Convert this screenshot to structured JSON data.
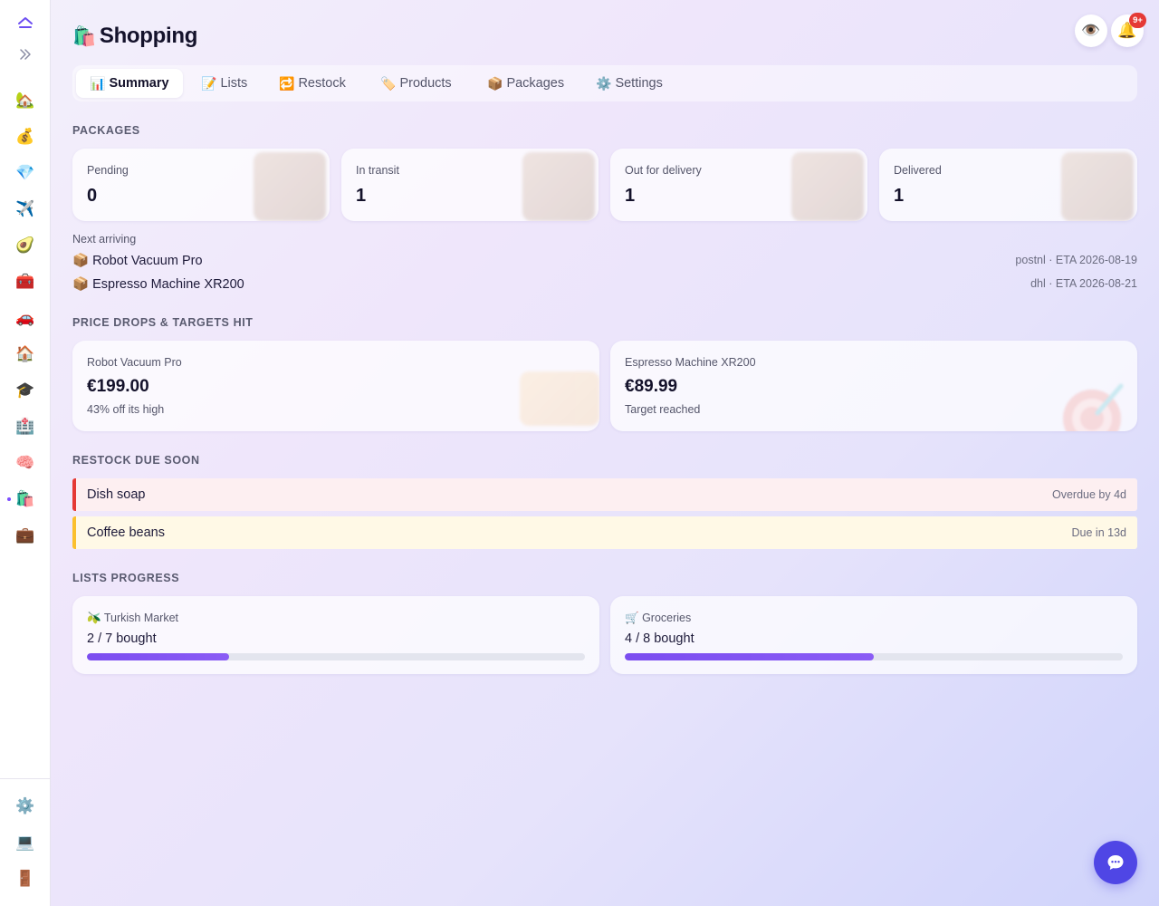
{
  "sidebar": {
    "top": [
      {
        "name": "home-up-icon",
        "glyph": "⏶"
      },
      {
        "name": "expand-icon",
        "glyph": "»"
      }
    ],
    "items": [
      {
        "name": "sidebar-item-house-building",
        "glyph": "🏡"
      },
      {
        "name": "sidebar-item-money",
        "glyph": "💰"
      },
      {
        "name": "sidebar-item-gem",
        "glyph": "💎"
      },
      {
        "name": "sidebar-item-travel",
        "glyph": "✈️"
      },
      {
        "name": "sidebar-item-food",
        "glyph": "🥑"
      },
      {
        "name": "sidebar-item-toolbox",
        "glyph": "🧰"
      },
      {
        "name": "sidebar-item-car",
        "glyph": "🚗"
      },
      {
        "name": "sidebar-item-home",
        "glyph": "🏠"
      },
      {
        "name": "sidebar-item-education",
        "glyph": "🎓"
      },
      {
        "name": "sidebar-item-health",
        "glyph": "🏥"
      },
      {
        "name": "sidebar-item-brain",
        "glyph": "🧠"
      },
      {
        "name": "sidebar-item-shopping",
        "glyph": "🛍️",
        "active": true
      },
      {
        "name": "sidebar-item-work",
        "glyph": "💼"
      }
    ],
    "bottom": [
      {
        "name": "settings-gear-icon",
        "glyph": "⚙️"
      },
      {
        "name": "laptop-icon",
        "glyph": "💻"
      },
      {
        "name": "logout-door-icon",
        "glyph": "🚪"
      }
    ]
  },
  "header": {
    "icon": "🛍️",
    "title": "Shopping",
    "eye_icon": "👁️",
    "bell_icon": "🔔",
    "notification_badge": "9+"
  },
  "tabs": [
    {
      "icon": "📊",
      "label": "Summary",
      "active": true
    },
    {
      "icon": "📝",
      "label": "Lists"
    },
    {
      "icon": "🔁",
      "label": "Restock"
    },
    {
      "icon": "🏷️",
      "label": "Products"
    },
    {
      "icon": "📦",
      "label": "Packages"
    },
    {
      "icon": "⚙️",
      "label": "Settings"
    }
  ],
  "packages": {
    "heading": "PACKAGES",
    "stats": [
      {
        "label": "Pending",
        "value": "0"
      },
      {
        "label": "In transit",
        "value": "1"
      },
      {
        "label": "Out for delivery",
        "value": "1"
      },
      {
        "label": "Delivered",
        "value": "1"
      }
    ],
    "next_label": "Next arriving",
    "arriving": [
      {
        "icon": "📦",
        "name": "Robot Vacuum Pro",
        "meta": "postnl · ETA 2026-08-19"
      },
      {
        "icon": "📦",
        "name": "Espresso Machine XR200",
        "meta": "dhl · ETA 2026-08-21"
      }
    ]
  },
  "price_drops": {
    "heading": "PRICE DROPS & TARGETS HIT",
    "items": [
      {
        "name": "Robot Vacuum Pro",
        "price": "€199.00",
        "note": "43% off its high"
      },
      {
        "name": "Espresso Machine XR200",
        "price": "€89.99",
        "note": "Target reached"
      }
    ]
  },
  "restock": {
    "heading": "RESTOCK DUE SOON",
    "items": [
      {
        "name": "Dish soap",
        "status": "Overdue by 4d",
        "accent": "#e53935",
        "bg": "#fdeff1"
      },
      {
        "name": "Coffee beans",
        "status": "Due in 13d",
        "accent": "#fbc02d",
        "bg": "#fff9e6"
      }
    ]
  },
  "lists_progress": {
    "heading": "LISTS PROGRESS",
    "items": [
      {
        "icon": "🫒",
        "name": "Turkish Market",
        "progress_text": "2 / 7 bought",
        "bought": 2,
        "total": 7
      },
      {
        "icon": "🛒",
        "name": "Groceries",
        "progress_text": "4 / 8 bought",
        "bought": 4,
        "total": 8
      }
    ]
  },
  "colors": {
    "accent": "#7c4dff",
    "chat_button": "#4f46e5",
    "progress_fill": "#7b4df0",
    "badge": "#e53935"
  }
}
